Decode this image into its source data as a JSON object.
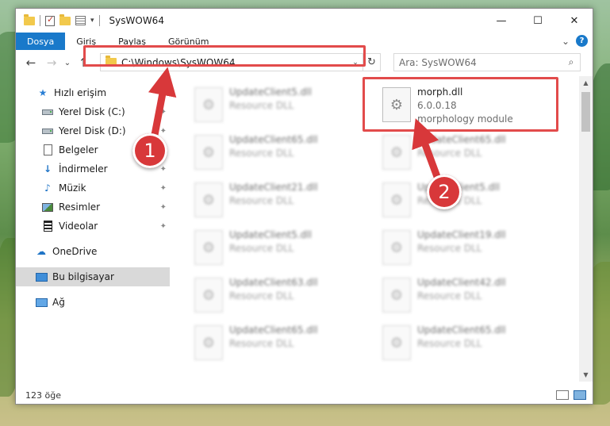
{
  "window": {
    "title": "SysWOW64",
    "controls": {
      "minimize": "—",
      "maximize": "☐",
      "close": "✕"
    }
  },
  "ribbon": {
    "tabs": [
      {
        "label": "Dosya",
        "active": true
      },
      {
        "label": "Giriş"
      },
      {
        "label": "Paylaş"
      },
      {
        "label": "Görünüm"
      }
    ],
    "expand_glyph": "⌄",
    "help_glyph": "?"
  },
  "nav": {
    "back": "←",
    "forward": "→",
    "recent": "⌄",
    "up": "↑"
  },
  "address": {
    "path": "C:\\Windows\\SysWOW64",
    "dropdown": "⌄",
    "refresh": "↻"
  },
  "search": {
    "placeholder": "Ara: SysWOW64",
    "icon": "search-icon"
  },
  "sidebar": {
    "items": [
      {
        "label": "Hızlı erişim",
        "icon": "star-icon",
        "pinned": false
      },
      {
        "label": "Yerel Disk (C:)",
        "icon": "drive-icon",
        "pinned": true
      },
      {
        "label": "Yerel Disk (D:)",
        "icon": "drive-icon",
        "pinned": true
      },
      {
        "label": "Belgeler",
        "icon": "documents-icon",
        "pinned": true
      },
      {
        "label": "İndirmeler",
        "icon": "download-icon",
        "pinned": true
      },
      {
        "label": "Müzik",
        "icon": "music-icon",
        "pinned": true
      },
      {
        "label": "Resimler",
        "icon": "pictures-icon",
        "pinned": true
      },
      {
        "label": "Videolar",
        "icon": "videos-icon",
        "pinned": true
      },
      {
        "label": "OneDrive",
        "icon": "cloud-icon"
      },
      {
        "label": "Bu bilgisayar",
        "icon": "computer-icon",
        "selected": true
      },
      {
        "label": "Ağ",
        "icon": "network-icon"
      }
    ],
    "pin_glyph": "📌"
  },
  "files": {
    "highlighted": {
      "name": "morph.dll",
      "version": "6.0.0.18",
      "description": "morphology module"
    },
    "left_column": [
      {
        "name": "UpdateClient5.dll",
        "type": "Resource DLL"
      },
      {
        "name": "UpdateClient65.dll",
        "type": "Resource DLL"
      },
      {
        "name": "UpdateClient21.dll",
        "type": "Resource DLL"
      },
      {
        "name": "UpdateClient5.dll",
        "type": "Resource DLL"
      },
      {
        "name": "UpdateClient63.dll",
        "type": "Resource DLL"
      },
      {
        "name": "UpdateClient65.dll",
        "type": "Resource DLL"
      }
    ],
    "right_column": [
      {
        "name": "UpdateClient65.dll",
        "type": "Resource DLL"
      },
      {
        "name": "UpdateClient5.dll",
        "type": "Resource DLL"
      },
      {
        "name": "UpdateClient19.dll",
        "type": "Resource DLL"
      },
      {
        "name": "UpdateClient42.dll",
        "type": "Resource DLL"
      },
      {
        "name": "UpdateClient65.dll",
        "type": "Resource DLL"
      }
    ]
  },
  "status": {
    "item_count": "123 öğe"
  },
  "annotations": {
    "step1": "1",
    "step2": "2",
    "highlight_color": "#e24b4b",
    "badge_color": "#d8383a"
  },
  "colors": {
    "accent": "#1979ca",
    "selection": "#d9d9d9"
  }
}
